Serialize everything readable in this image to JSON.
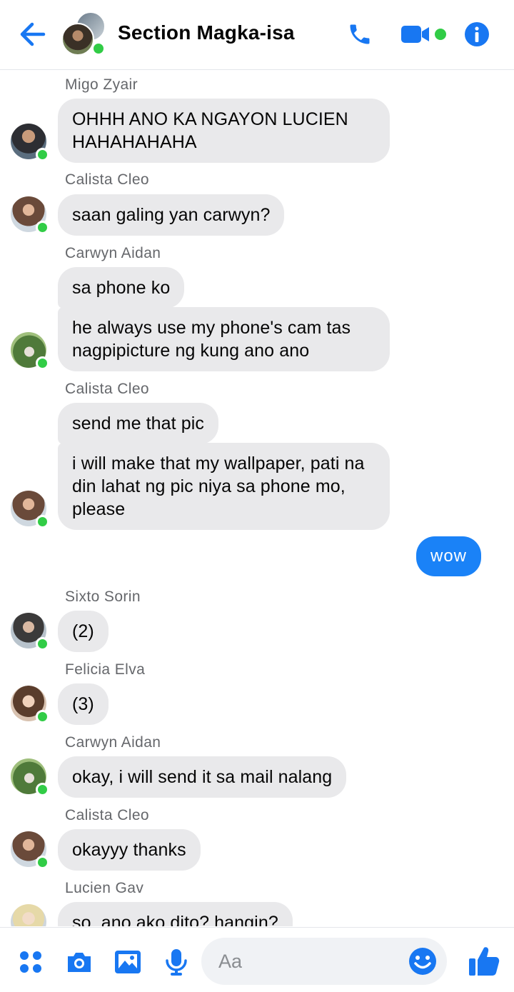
{
  "header": {
    "title": "Section Magka-isa",
    "back_icon": "back-arrow-icon",
    "call_icon": "phone-icon",
    "video_icon": "video-camera-icon",
    "info_icon": "info-icon",
    "accent_color": "#1877f2",
    "online_color": "#31cc46"
  },
  "messages": [
    {
      "sender": "Migo Zyair",
      "texts": [
        "OHHH ANO KA NGAYON LUCIEN HAHAHAHAHA"
      ]
    },
    {
      "sender": "Calista Cleo",
      "texts": [
        "saan galing yan carwyn?"
      ]
    },
    {
      "sender": "Carwyn Aidan",
      "texts": [
        "sa phone ko",
        "he always use my phone's cam tas nagpipicture ng kung ano ano"
      ]
    },
    {
      "sender": "Calista Cleo",
      "texts": [
        "send me that pic",
        "i will make that my wallpaper, pati na din lahat ng pic niya sa phone mo, please"
      ]
    },
    {
      "sender": "",
      "texts": [
        "wow"
      ],
      "outgoing": true
    },
    {
      "sender": "Sixto Sorin",
      "texts": [
        "(2)"
      ]
    },
    {
      "sender": "Felicia Elva",
      "texts": [
        "(3)"
      ]
    },
    {
      "sender": "Carwyn Aidan",
      "texts": [
        "okay, i will send it sa mail nalang"
      ]
    },
    {
      "sender": "Calista Cleo",
      "texts": [
        "okayyy thanks"
      ]
    },
    {
      "sender": "Lucien Gav",
      "texts": [
        "so, ano ako dito? hangin?"
      ]
    }
  ],
  "composer": {
    "placeholder": "Aa",
    "icons": [
      "menu-dots-icon",
      "camera-icon",
      "gallery-icon",
      "microphone-icon",
      "emoji-icon",
      "thumbs-up-icon"
    ]
  }
}
